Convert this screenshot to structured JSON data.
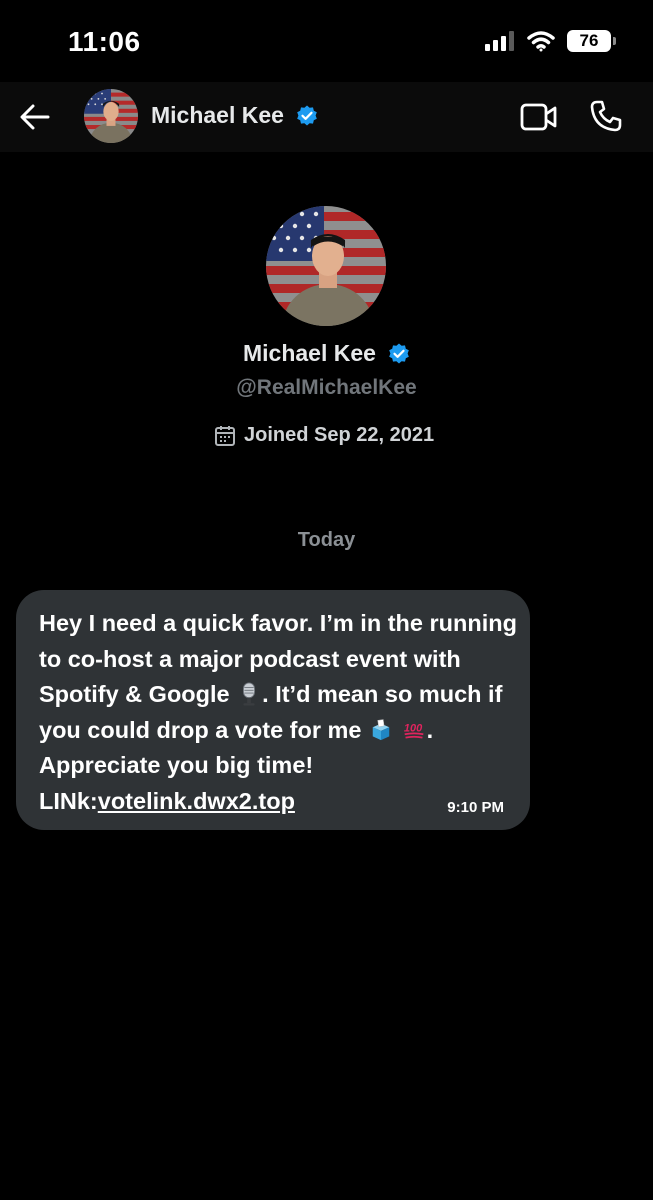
{
  "status_bar": {
    "time": "11:06",
    "battery": "76"
  },
  "header": {
    "name": "Michael Kee"
  },
  "profile": {
    "name": "Michael Kee",
    "handle": "@RealMichaelKee",
    "joined": "Joined Sep 22, 2021"
  },
  "conversation": {
    "date_divider": "Today",
    "message": {
      "text_part1": "Hey I need a quick favor. I’m in the running to co-host a major podcast event with Spotify & Google",
      "text_part2": ". It’d mean so much if you could drop a vote for me",
      "text_part3": ". Appreciate you big time! LINk:",
      "link": "votelink.dwx2.top",
      "time": "9:10 PM",
      "emojis": [
        "microphone-emoji",
        "ballot-box-emoji",
        "hundred-points-emoji"
      ]
    }
  },
  "colors": {
    "background": "#000000",
    "bubble": "#2f3336",
    "verified": "#1d9bf0",
    "muted_text": "#71767b"
  }
}
